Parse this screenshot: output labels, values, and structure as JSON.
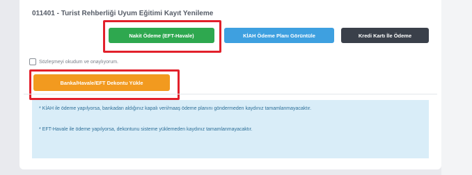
{
  "course": {
    "title": "011401 - Turist Rehberliği Uyum Eğitimi Kayıt Yenileme"
  },
  "payment_buttons": {
    "cash_label": "Nakit Ödeme (EFT-Havale)",
    "plan_label": "KİAH Ödeme Planı Görüntüle",
    "card_label": "Kredi Kartı İle Ödeme"
  },
  "agreement": {
    "label": "Sözleşmeyi okudum ve onaylıyorum."
  },
  "upload": {
    "label": "Banka/Havale/EFT Dekontu Yükle"
  },
  "info": {
    "note_1": "* KİAH ile ödeme yapılyorsa, bankadan aldığınız kapalı veri/maaş ödeme planını göndermeden kaydınız tamamlanmayacaktır.",
    "note_2": "* EFT-Havale ile ödeme yapılyorsa, dekontunu sisteme yüklemeden kaydınız tamamlanmayacaktır."
  },
  "colors": {
    "cash_button": "#2ea84f",
    "plan_button": "#3ea0e0",
    "card_button": "#3a404a",
    "upload_button": "#f29a1f",
    "highlight": "#e2202b",
    "info_background": "#d9edf8"
  }
}
